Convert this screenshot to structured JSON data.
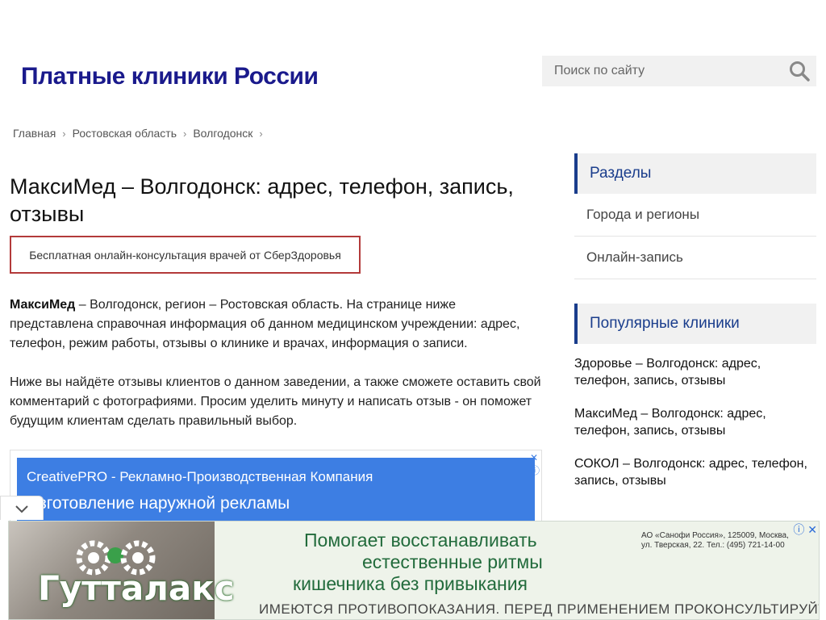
{
  "header": {
    "site_title": "Платные клиники России",
    "search": {
      "placeholder": "Поиск по сайту"
    }
  },
  "breadcrumb": {
    "items": [
      "Главная",
      "Ростовская область",
      "Волгодонск"
    ],
    "separator": "›"
  },
  "main": {
    "title": "МаксиМед – Волгодонск: адрес, телефон, запись, отзывы",
    "promo_label": "Бесплатная онлайн-консультация врачей от СберЗдоровья",
    "intro_bold": "МаксиМед",
    "intro_rest": " – Волгодонск, регион – Ростовская область. На странице ниже представлена справочная информация об данном медицинском учреждении: адрес, телефон, режим работы, отзывы о клинике и врачах, информация о записи.",
    "intro2": "Ниже вы найдёте отзывы клиентов о данном заведении, а также сможете оставить свой комментарий с фотографиями. Просим уделить минуту и написать отзыв - он поможет будущим клиентам сделать правильный выбор.",
    "ad": {
      "title": "CreativePRO - Рекламно-Производственная Компания",
      "subtitle": "Изготовление наружной рекламы"
    }
  },
  "sidebar": {
    "sections_title": "Разделы",
    "sections": [
      "Города и регионы",
      "Онлайн-запись"
    ],
    "popular_title": "Популярные клиники",
    "popular": [
      "Здоровье – Волгодонск: адрес, телефон, запись, отзывы",
      "МаксиМед – Волгодонск: адрес, телефон, запись, отзывы",
      "СОКОЛ – Волгодонск: адрес, телефон, запись, отзывы"
    ]
  },
  "bottom_ad": {
    "brand": "Гутталакс",
    "headline_1": "Помогает восстанавливать",
    "headline_2": "естественные ритмы",
    "headline_3": "кишечника без привыкания",
    "company": "АО «Санофи Россия», 125009, Москва, ул. Тверская, 22. Тел.: (495) 721-14-00",
    "warning": "ИМЕЮТСЯ ПРОТИВОПОКАЗАНИЯ. ПЕРЕД ПРИМЕНЕНИЕМ ПРОКОНСУЛЬТИРУЙТЕСЬ СО СПЕЦИАЛИСТОМ."
  },
  "colors": {
    "title_blue": "#1a1a8c",
    "sidebar_accent": "#1a3d8c",
    "promo_border": "#b33a3a",
    "ad_blue": "#3d7ee3",
    "ad_green": "#226b3c"
  }
}
